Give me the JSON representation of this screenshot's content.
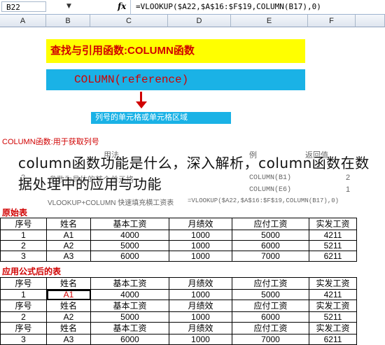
{
  "formula_bar": {
    "cell_ref": "B22",
    "fx": "fx",
    "formula": "=VLOOKUP($A22,$A$16:$F$19,COLUMN(B17),0)"
  },
  "columns": [
    "A",
    "B",
    "C",
    "D",
    "E",
    "F"
  ],
  "banners": {
    "title": "查找与引用函数:COLUMN函数",
    "syntax": "COLUMN(reference)",
    "param": "列号的单元格或单元格区域"
  },
  "usage": {
    "label": "COLUMN函数:用于获取列号",
    "headers": {
      "usage": "用法",
      "example": "例",
      "result": "返回值"
    },
    "rows": [
      {
        "num": "2",
        "desc": "参数为具体的某个单元格",
        "example": "COLUMN(B1)",
        "result": "2"
      },
      {
        "num": "",
        "desc": "",
        "example": "COLUMN(E6)",
        "result": "1"
      },
      {
        "num": "",
        "desc": "VLOOKUP+COLUMN 快速填充横工资表",
        "example": "=VLOOKUP($A22,$A$16:$F$19,COLUMN(B17),0)",
        "result": ""
      }
    ]
  },
  "original_table": {
    "label": "原始表",
    "headers": [
      "序号",
      "姓名",
      "基本工资",
      "月绩效",
      "应付工资",
      "实发工资"
    ],
    "rows": [
      [
        "1",
        "A1",
        "4000",
        "1000",
        "5000",
        "4211"
      ],
      [
        "2",
        "A2",
        "5000",
        "1000",
        "6000",
        "5211"
      ],
      [
        "3",
        "A3",
        "6000",
        "1000",
        "7000",
        "6211"
      ]
    ]
  },
  "formula_table": {
    "label": "应用公式后的表",
    "blocks": [
      {
        "headers": [
          "序号",
          "姓名",
          "基本工资",
          "月绩效",
          "应付工资",
          "实发工资"
        ],
        "row": [
          "1",
          "A1",
          "4000",
          "1000",
          "5000",
          "4211"
        ]
      },
      {
        "headers": [
          "序号",
          "姓名",
          "基本工资",
          "月绩效",
          "应付工资",
          "实发工资"
        ],
        "row": [
          "2",
          "A2",
          "5000",
          "1000",
          "6000",
          "5211"
        ]
      },
      {
        "headers": [
          "序号",
          "姓名",
          "基本工资",
          "月绩效",
          "应付工资",
          "实发工资"
        ],
        "row": [
          "3",
          "A3",
          "6000",
          "1000",
          "7000",
          "6211"
        ]
      }
    ]
  },
  "overlay_text": "column函数功能是什么，深入解析，column函数在数据处理中的应用与功能"
}
